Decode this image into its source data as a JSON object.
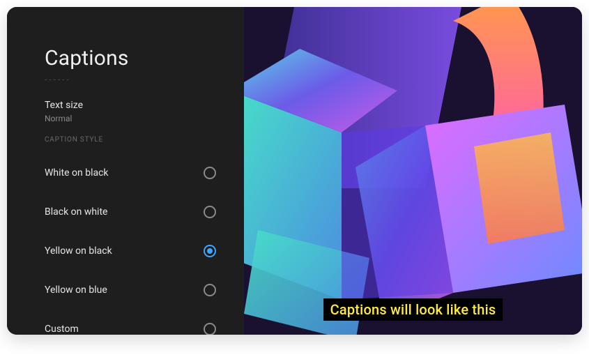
{
  "page": {
    "title": "Captions",
    "prev_hint": "- - - - - -"
  },
  "text_size": {
    "label": "Text size",
    "value": "Normal"
  },
  "section_header": "CAPTION STYLE",
  "options": [
    {
      "label": "White on black",
      "selected": false
    },
    {
      "label": "Black on white",
      "selected": false
    },
    {
      "label": "Yellow on black",
      "selected": true
    },
    {
      "label": "Yellow on blue",
      "selected": false
    },
    {
      "label": "Custom",
      "selected": false
    }
  ],
  "preview": {
    "caption_text": "Captions will look like this"
  },
  "colors": {
    "accent": "#3ea6ff",
    "caption_fg": "#ffeb3b",
    "caption_bg": "#000000"
  }
}
